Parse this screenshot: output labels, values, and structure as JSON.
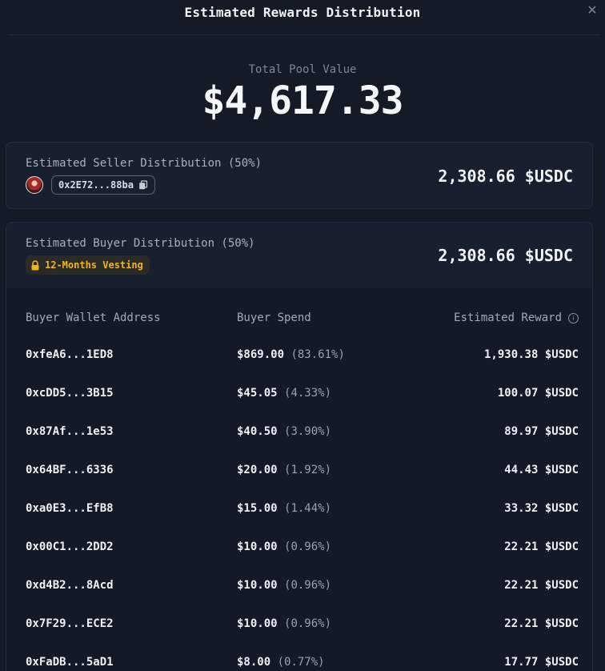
{
  "header": {
    "title": "Estimated Rewards Distribution",
    "close_glyph": "✕"
  },
  "pool": {
    "label": "Total Pool Value",
    "value": "$4,617.33"
  },
  "seller": {
    "label": "Estimated Seller Distribution (50%)",
    "address": "0x2E72...88ba",
    "amount": "2,308.66 $USDC"
  },
  "buyer": {
    "label": "Estimated Buyer Distribution (50%)",
    "vesting": "12-Months Vesting",
    "amount": "2,308.66 $USDC"
  },
  "table": {
    "headers": {
      "wallet": "Buyer Wallet Address",
      "spend": "Buyer Spend",
      "reward": "Estimated Reward"
    },
    "rows": [
      {
        "wallet": "0xfeA6...1ED8",
        "spend": "$869.00",
        "pct": "(83.61%)",
        "reward": "1,930.38 $USDC"
      },
      {
        "wallet": "0xcDD5...3B15",
        "spend": "$45.05",
        "pct": "(4.33%)",
        "reward": "100.07 $USDC"
      },
      {
        "wallet": "0x87Af...1e53",
        "spend": "$40.50",
        "pct": "(3.90%)",
        "reward": "89.97 $USDC"
      },
      {
        "wallet": "0x64BF...6336",
        "spend": "$20.00",
        "pct": "(1.92%)",
        "reward": "44.43 $USDC"
      },
      {
        "wallet": "0xa0E3...EfB8",
        "spend": "$15.00",
        "pct": "(1.44%)",
        "reward": "33.32 $USDC"
      },
      {
        "wallet": "0x00C1...2DD2",
        "spend": "$10.00",
        "pct": "(0.96%)",
        "reward": "22.21 $USDC"
      },
      {
        "wallet": "0xd4B2...8Acd",
        "spend": "$10.00",
        "pct": "(0.96%)",
        "reward": "22.21 $USDC"
      },
      {
        "wallet": "0x7F29...ECE2",
        "spend": "$10.00",
        "pct": "(0.96%)",
        "reward": "22.21 $USDC"
      },
      {
        "wallet": "0xFaDB...5aD1",
        "spend": "$8.00",
        "pct": "(0.77%)",
        "reward": "17.77 $USDC"
      }
    ]
  },
  "icons": {
    "close": "close-icon",
    "copy": "copy-icon",
    "lock": "lock-icon",
    "info": "info-icon",
    "avatar": "avatar"
  },
  "colors": {
    "background": "#141a26",
    "card": "#182030",
    "vesting_accent": "#f0b429",
    "text_primary": "#eef1f5",
    "text_muted": "#9aa2ae"
  }
}
